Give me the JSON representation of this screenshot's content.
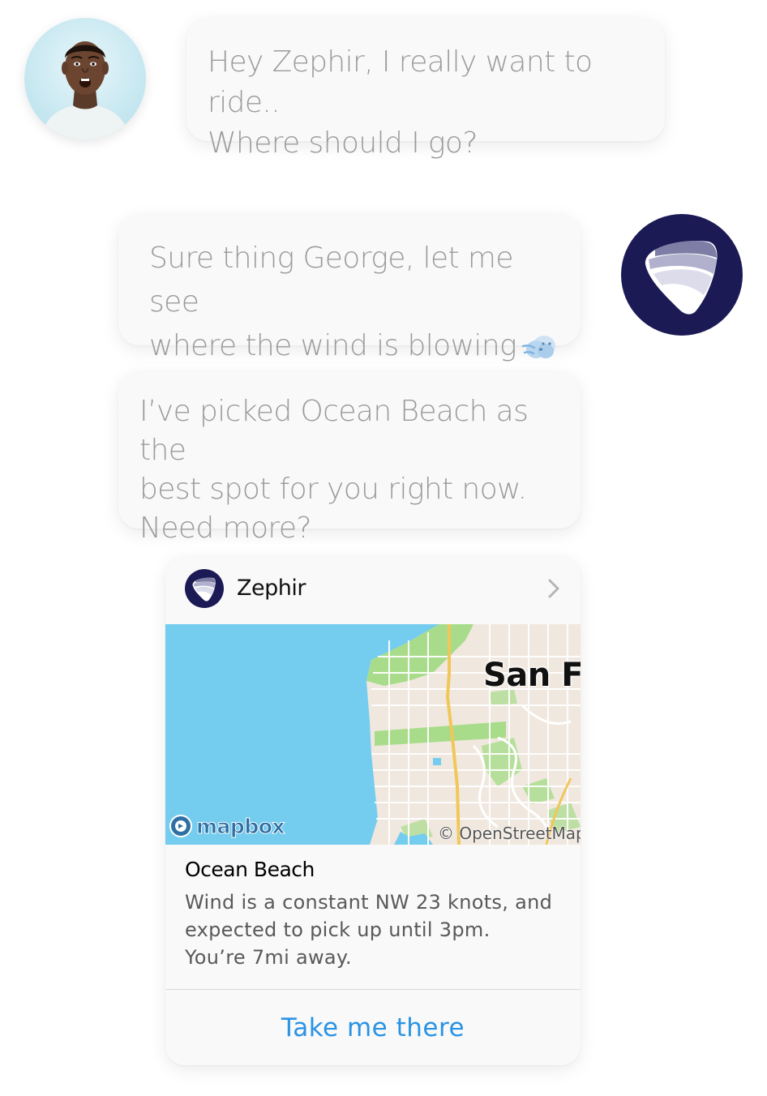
{
  "conversation": {
    "user_message": "Hey Zephir, I really want to ride..\nWhere should I go?",
    "bot_message_1": "Sure thing George, let me see\nwhere the wind is blowing",
    "bot_message_1_emoji": "wind-blowing-face-icon",
    "bot_message_2": "I’ve picked Ocean Beach as the\nbest spot for you right now.\nNeed more?"
  },
  "avatars": {
    "user": "user-photo",
    "bot": "zephir-logo-icon",
    "bot_color": "#1c1a55"
  },
  "card": {
    "app_name": "Zephir",
    "map": {
      "city_label": "San Fr",
      "brand": "mapbox",
      "attribution": "© OpenStreetMap",
      "water_color": "#74cdef",
      "land_color": "#f0e8de",
      "park_color": "#a8dc8a"
    },
    "place_title": "Ocean Beach",
    "place_description": "Wind is a constant NW 23 knots, and\nexpected to pick up until 3pm.\nYou’re 7mi away.",
    "action_label": "Take me there",
    "action_color": "#2a93e4"
  }
}
